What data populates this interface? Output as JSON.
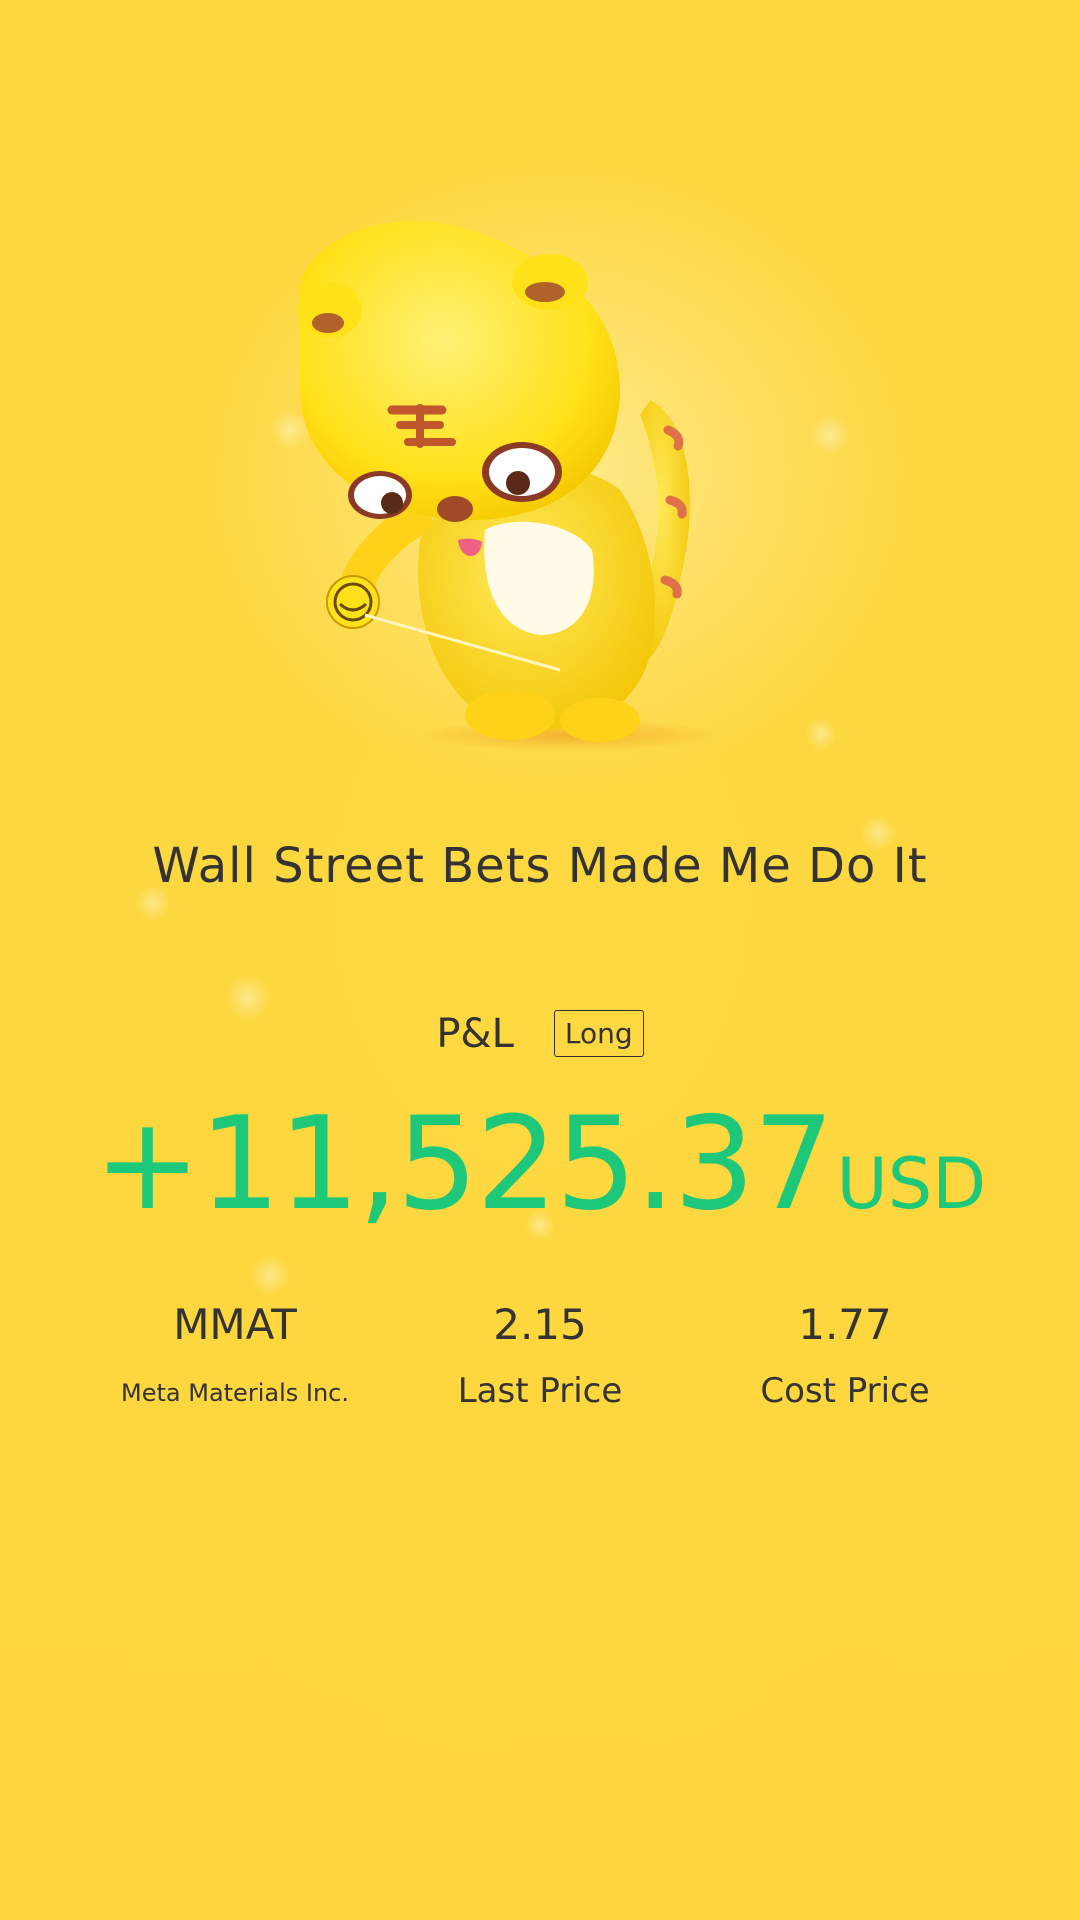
{
  "title": "Wall Street Bets Made Me Do It",
  "pnl": {
    "label": "P&L",
    "side": "Long",
    "amount": "+11,525.37",
    "currency": "USD"
  },
  "stats": {
    "symbol": "MMAT",
    "company": "Meta Materials Inc.",
    "last_price_value": "2.15",
    "last_price_label": "Last Price",
    "cost_price_value": "1.77",
    "cost_price_label": "Cost Price"
  },
  "illustration": {
    "icon": "tiger-mascot-icon"
  },
  "colors": {
    "background": "#fdd63c",
    "profit": "#1ec87a",
    "text": "#333333"
  }
}
